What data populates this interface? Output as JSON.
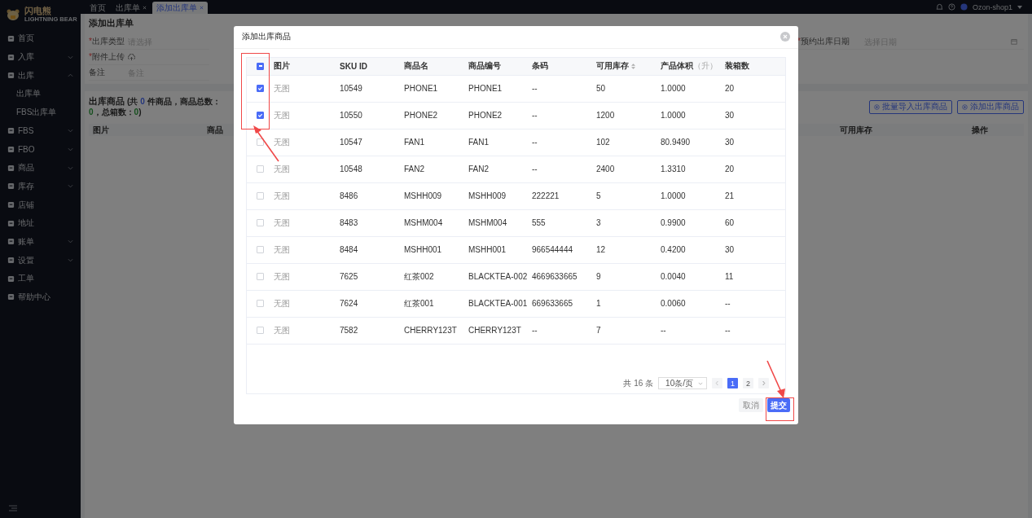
{
  "brand": {
    "name": "闪电熊",
    "tagline": "LIGHTNING BEAR"
  },
  "sidebar": {
    "items": [
      {
        "label": "首页",
        "kind": "link"
      },
      {
        "label": "入库",
        "kind": "group",
        "expanded": false
      },
      {
        "label": "出库",
        "kind": "group",
        "expanded": true,
        "children": [
          {
            "label": "出库单"
          },
          {
            "label": "FBS出库单"
          }
        ]
      },
      {
        "label": "FBS",
        "kind": "group",
        "expanded": false
      },
      {
        "label": "FBO",
        "kind": "group",
        "expanded": false
      },
      {
        "label": "商品",
        "kind": "group",
        "expanded": false
      },
      {
        "label": "库存",
        "kind": "group",
        "expanded": false
      },
      {
        "label": "店铺",
        "kind": "link"
      },
      {
        "label": "地址",
        "kind": "link"
      },
      {
        "label": "账单",
        "kind": "group",
        "expanded": false
      },
      {
        "label": "设置",
        "kind": "group",
        "expanded": false
      },
      {
        "label": "工单",
        "kind": "link"
      },
      {
        "label": "帮助中心",
        "kind": "link"
      }
    ]
  },
  "tabs": [
    {
      "label": "首页",
      "closable": false,
      "selected": false
    },
    {
      "label": "出库单",
      "closable": true,
      "selected": false
    },
    {
      "label": "添加出库单",
      "closable": true,
      "selected": true
    }
  ],
  "user": {
    "name": "Ozon-shop1"
  },
  "page": {
    "title": "添加出库单",
    "required_mark": "*",
    "form": [
      {
        "label": "出库类型",
        "required": true,
        "kind": "select",
        "placeholder": "请选择"
      },
      {
        "label": "附件上传",
        "required": true,
        "kind": "upload"
      },
      {
        "label": "备注",
        "required": false,
        "kind": "text",
        "placeholder": "备注"
      }
    ],
    "date_field": {
      "label": "预约出库日期",
      "required": true,
      "placeholder": "选择日期"
    },
    "section": {
      "title": "出库商品",
      "summary": [
        "(共 ",
        "0",
        " 件商品，商品总数：",
        "0",
        "，总箱数：",
        "0",
        ")"
      ],
      "buttons": [
        "批量导入出库商品",
        "添加出库商品"
      ],
      "columns": [
        "图片",
        "商品",
        "可用库存",
        "操作"
      ]
    }
  },
  "modal": {
    "title": "添加出库商品",
    "header_checkbox": {
      "indeterminate": true
    },
    "columns": [
      {
        "label": "图片",
        "sortable": false
      },
      {
        "label": "SKU ID",
        "sortable": false
      },
      {
        "label": "商品名",
        "sortable": false
      },
      {
        "label": "商品编号",
        "sortable": false
      },
      {
        "label": "条码",
        "sortable": false
      },
      {
        "label": "可用库存",
        "sortable": true
      },
      {
        "label": "产品体积",
        "unit": "（升）",
        "sortable": false
      },
      {
        "label": "装箱数",
        "sortable": false
      }
    ],
    "rows": [
      {
        "checked": true,
        "image": "无图",
        "sku": "10549",
        "name": "PHONE1",
        "code": "PHONE1",
        "barcode": "--",
        "stock": "50",
        "volume": "1.0000",
        "per_box": "20"
      },
      {
        "checked": true,
        "image": "无图",
        "sku": "10550",
        "name": "PHONE2",
        "code": "PHONE2",
        "barcode": "--",
        "stock": "1200",
        "volume": "1.0000",
        "per_box": "30"
      },
      {
        "checked": false,
        "image": "无图",
        "sku": "10547",
        "name": "FAN1",
        "code": "FAN1",
        "barcode": "--",
        "stock": "102",
        "volume": "80.9490",
        "per_box": "30"
      },
      {
        "checked": false,
        "image": "无图",
        "sku": "10548",
        "name": "FAN2",
        "code": "FAN2",
        "barcode": "--",
        "stock": "2400",
        "volume": "1.3310",
        "per_box": "20"
      },
      {
        "checked": false,
        "image": "无图",
        "sku": "8486",
        "name": "MSHH009",
        "code": "MSHH009",
        "barcode": "222221",
        "stock": "5",
        "volume": "1.0000",
        "per_box": "21"
      },
      {
        "checked": false,
        "image": "无图",
        "sku": "8483",
        "name": "MSHM004",
        "code": "MSHM004",
        "barcode": "555",
        "stock": "3",
        "volume": "0.9900",
        "per_box": "60"
      },
      {
        "checked": false,
        "image": "无图",
        "sku": "8484",
        "name": "MSHH001",
        "code": "MSHH001",
        "barcode": "966544444",
        "stock": "12",
        "volume": "0.4200",
        "per_box": "30"
      },
      {
        "checked": false,
        "image": "无图",
        "sku": "7625",
        "name": "红茶002",
        "code": "BLACKTEA-002",
        "barcode": "4669633665",
        "stock": "9",
        "volume": "0.0040",
        "per_box": "11"
      },
      {
        "checked": false,
        "image": "无图",
        "sku": "7624",
        "name": "红茶001",
        "code": "BLACKTEA-001",
        "barcode": "669633665",
        "stock": "1",
        "volume": "0.0060",
        "per_box": "--"
      },
      {
        "checked": false,
        "image": "无图",
        "sku": "7582",
        "name": "CHERRY123T",
        "code": "CHERRY123T",
        "barcode": "--",
        "stock": "7",
        "volume": "--",
        "per_box": "--"
      }
    ],
    "pagination": {
      "total": "共 16 条",
      "page_size": "10条/页",
      "pages": [
        {
          "label": "1",
          "selected": true
        },
        {
          "label": "2",
          "selected": false
        }
      ]
    },
    "buttons": {
      "cancel": "取消",
      "submit": "提交"
    }
  }
}
